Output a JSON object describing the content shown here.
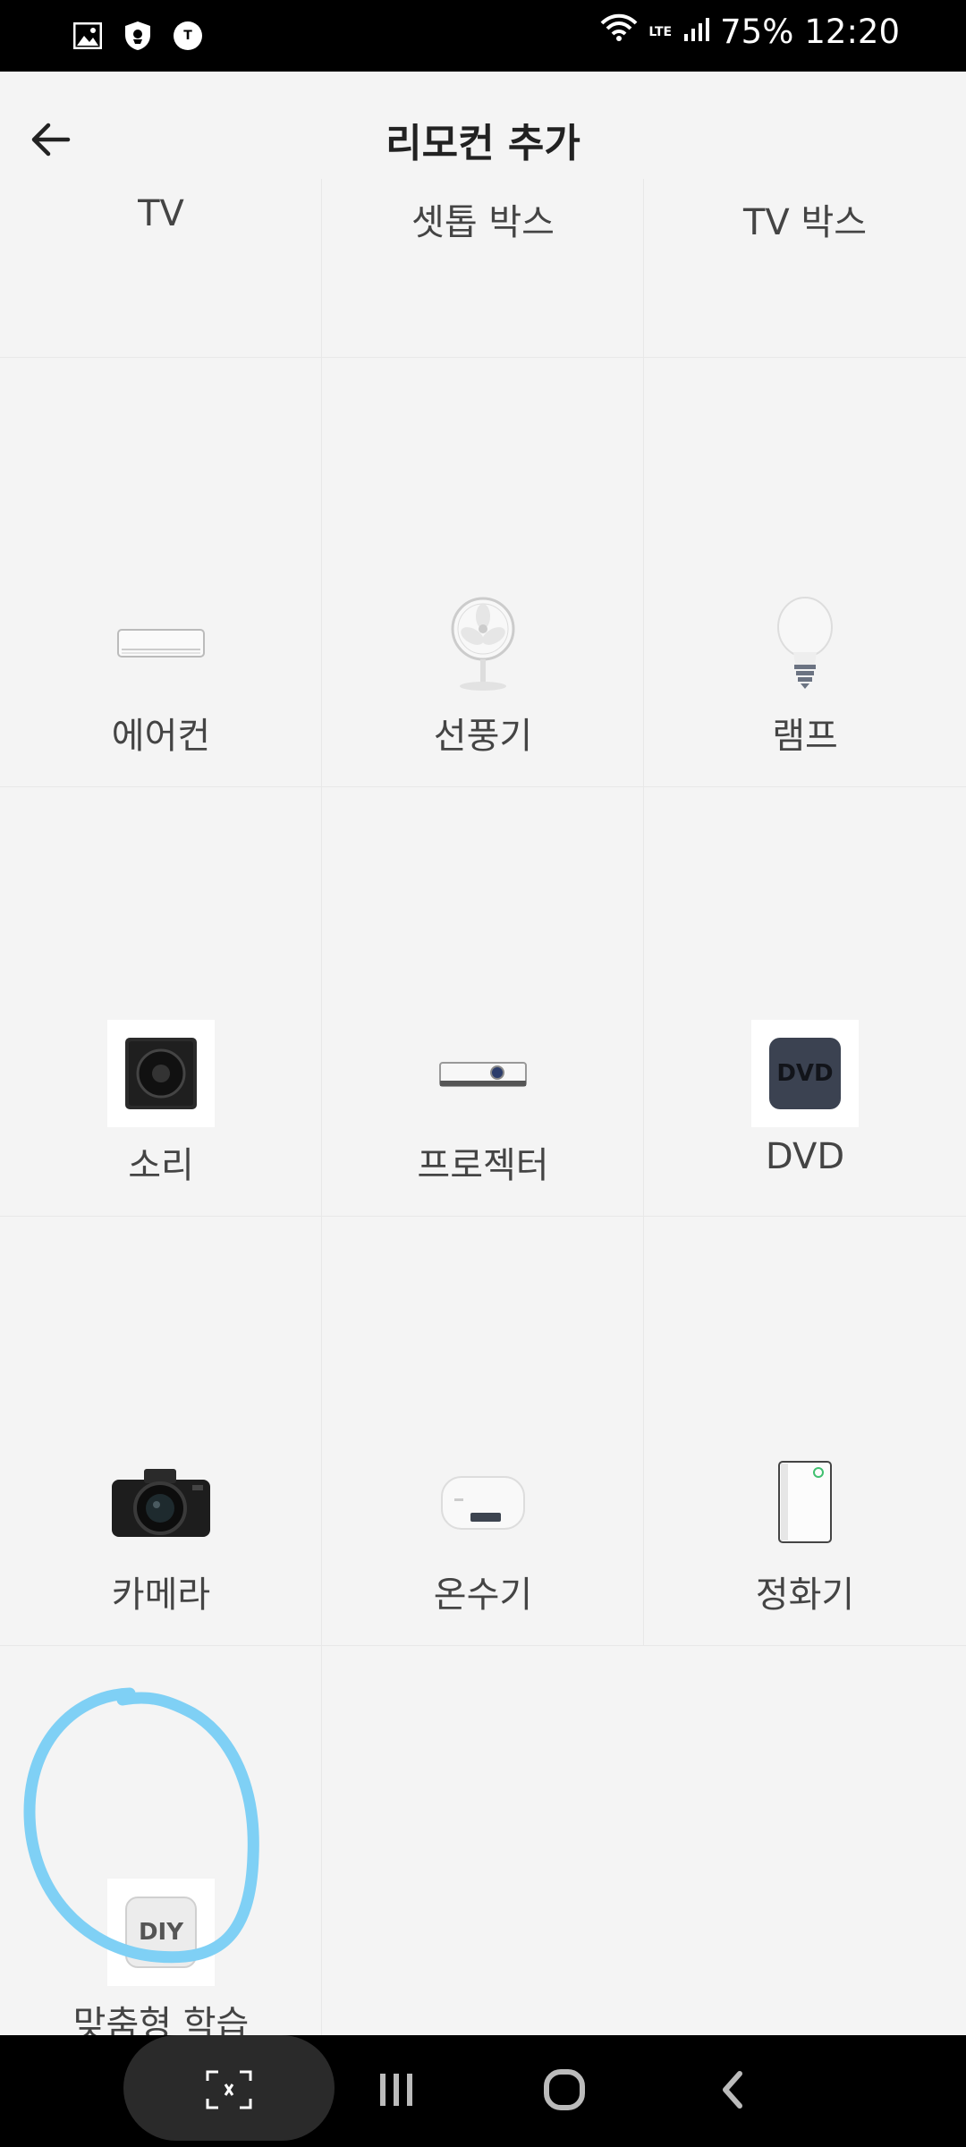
{
  "status": {
    "battery": "75%",
    "time": "12:20",
    "network": "LTE"
  },
  "header": {
    "title": "리모컨 추가"
  },
  "top_row": [
    "TV",
    "셋톱 박스",
    "TV 박스"
  ],
  "devices": [
    {
      "label": "에어컨",
      "icon": "air-conditioner-icon"
    },
    {
      "label": "선풍기",
      "icon": "fan-icon"
    },
    {
      "label": "램프",
      "icon": "lamp-icon"
    },
    {
      "label": "소리",
      "icon": "speaker-icon"
    },
    {
      "label": "프로젝터",
      "icon": "projector-icon"
    },
    {
      "label": "DVD",
      "icon": "dvd-icon"
    },
    {
      "label": "카메라",
      "icon": "camera-icon"
    },
    {
      "label": "온수기",
      "icon": "water-heater-icon"
    },
    {
      "label": "정화기",
      "icon": "purifier-icon"
    },
    {
      "label": "맞춤형 학습",
      "icon": "diy-icon"
    }
  ],
  "icon_texts": {
    "dvd": "DVD",
    "diy": "DIY"
  },
  "colors": {
    "annotation": "#7fd0f5",
    "background": "#f4f4f4"
  }
}
